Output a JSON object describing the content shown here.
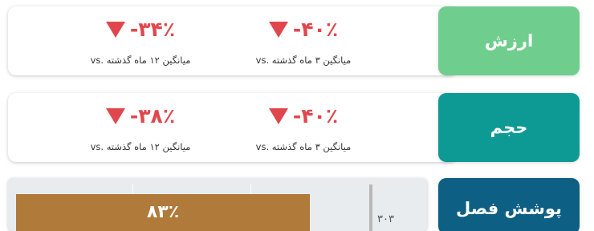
{
  "rows": [
    {
      "label": "ارزش",
      "color": "#6fce8d",
      "metrics": [
        {
          "delta": "-۴۰٪",
          "caption": "میانگین ۳ ماه گذشته",
          "vs": "vs."
        },
        {
          "delta": "-۳۴٪",
          "caption": "میانگین ۱۲ ماه گذشته",
          "vs": "vs."
        }
      ]
    },
    {
      "label": "حجم",
      "color": "#0e9a94",
      "metrics": [
        {
          "delta": "-۴۰٪",
          "caption": "میانگین ۳ ماه گذشته",
          "vs": "vs."
        },
        {
          "delta": "-۳۸٪",
          "caption": "میانگین ۱۲ ماه گذشته",
          "vs": "vs."
        }
      ]
    }
  ],
  "coverage": {
    "label": "پوشش فصل",
    "color": "#0d5f83",
    "bar_color": "#b07a3a",
    "percent_text": "۸۳٪",
    "percent": 83,
    "marker_value": "۳۰۳"
  },
  "colors": {
    "negative": "#e0474c"
  }
}
